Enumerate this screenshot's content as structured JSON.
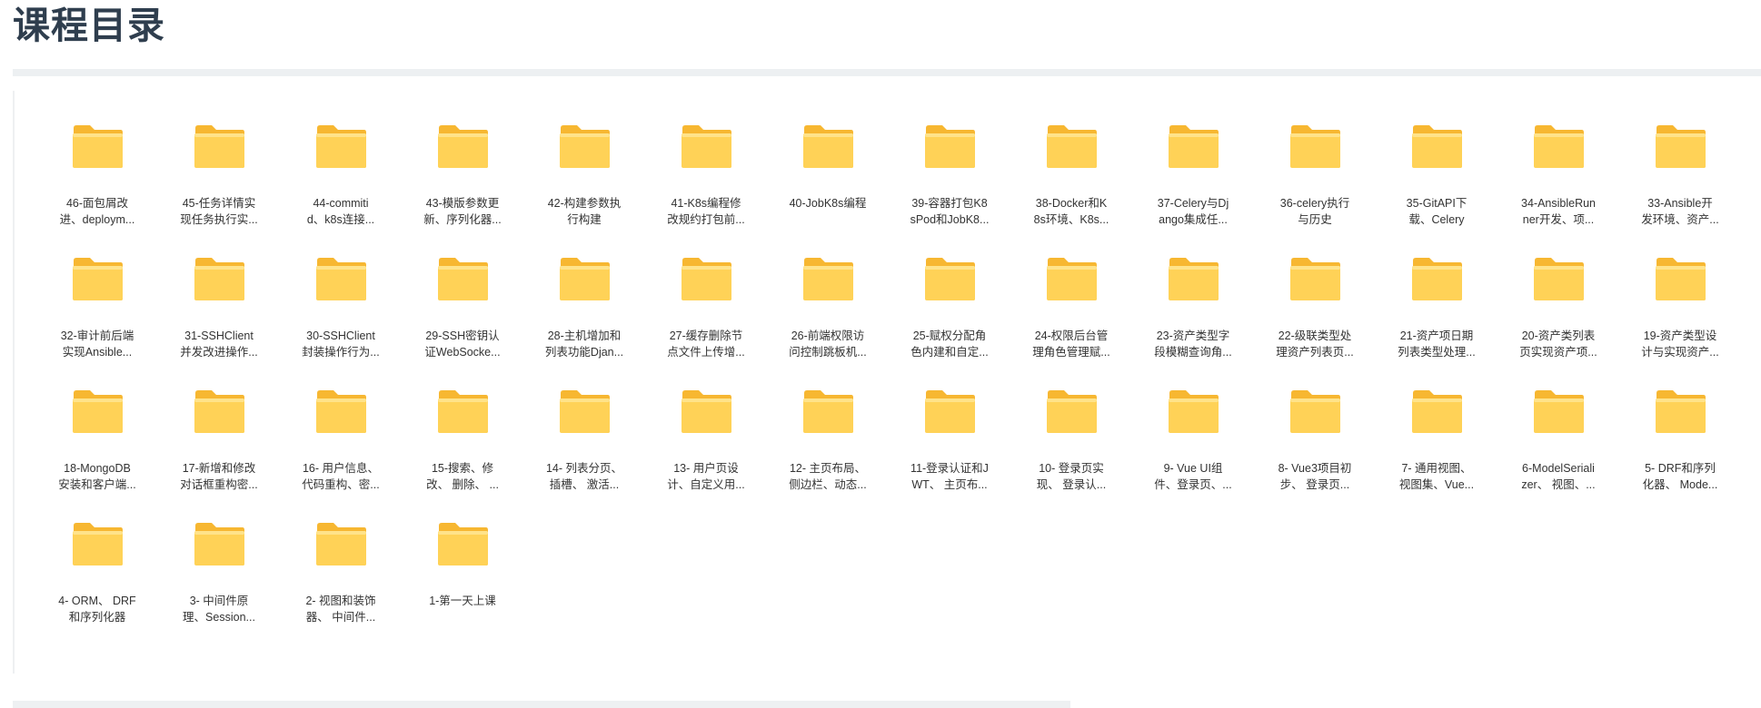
{
  "page": {
    "title": "课程目录"
  },
  "colors": {
    "folder_back": "#f7b731",
    "folder_front": "#ffd257",
    "folder_light": "#ffe38a"
  },
  "folders": [
    {
      "label1": "46-面包屑改",
      "label2": "进、deploym..."
    },
    {
      "label1": "45-任务详情实",
      "label2": "现任务执行实..."
    },
    {
      "label1": "44-commiti",
      "label2": "d、k8s连接..."
    },
    {
      "label1": "43-模版参数更",
      "label2": "新、序列化器..."
    },
    {
      "label1": "42-构建参数执",
      "label2": "行构建"
    },
    {
      "label1": "41-K8s编程修",
      "label2": "改规约打包前..."
    },
    {
      "label1": "40-JobK8s编程",
      "label2": ""
    },
    {
      "label1": "39-容器打包K8",
      "label2": "sPod和JobK8..."
    },
    {
      "label1": "38-Docker和K",
      "label2": "8s环境、K8s..."
    },
    {
      "label1": "37-Celery与Dj",
      "label2": "ango集成任..."
    },
    {
      "label1": "36-celery执行",
      "label2": "与历史"
    },
    {
      "label1": "35-GitAPI下",
      "label2": "载、Celery"
    },
    {
      "label1": "34-AnsibleRun",
      "label2": "ner开发、项..."
    },
    {
      "label1": "33-Ansible开",
      "label2": "发环境、资产..."
    },
    {
      "label1": "32-审计前后端",
      "label2": "实现Ansible..."
    },
    {
      "label1": "31-SSHClient",
      "label2": "并发改进操作..."
    },
    {
      "label1": "30-SSHClient",
      "label2": "封装操作行为..."
    },
    {
      "label1": "29-SSH密钥认",
      "label2": "证WebSocke..."
    },
    {
      "label1": "28-主机增加和",
      "label2": "列表功能Djan..."
    },
    {
      "label1": "27-缓存删除节",
      "label2": "点文件上传增..."
    },
    {
      "label1": "26-前端权限访",
      "label2": "问控制跳板机..."
    },
    {
      "label1": "25-赋权分配角",
      "label2": "色内建和自定..."
    },
    {
      "label1": "24-权限后台管",
      "label2": "理角色管理赋..."
    },
    {
      "label1": "23-资产类型字",
      "label2": "段模糊查询角..."
    },
    {
      "label1": "22-级联类型处",
      "label2": "理资产列表页..."
    },
    {
      "label1": "21-资产项日期",
      "label2": "列表类型处理..."
    },
    {
      "label1": "20-资产类列表",
      "label2": "页实现资产项..."
    },
    {
      "label1": "19-资产类型设",
      "label2": "计与实现资产..."
    },
    {
      "label1": "18-MongoDB",
      "label2": "安装和客户端..."
    },
    {
      "label1": "17-新增和修改",
      "label2": "对话框重构密..."
    },
    {
      "label1": "16- 用户信息、",
      "label2": "代码重构、密..."
    },
    {
      "label1": "15-搜索、修",
      "label2": "改、 删除、 ..."
    },
    {
      "label1": "14- 列表分页、",
      "label2": "插槽、 激活..."
    },
    {
      "label1": "13- 用户页设",
      "label2": "计、自定义用..."
    },
    {
      "label1": "12- 主页布局、",
      "label2": "侧边栏、动态..."
    },
    {
      "label1": "11-登录认证和J",
      "label2": "WT、 主页布..."
    },
    {
      "label1": "10- 登录页实",
      "label2": "现、 登录认..."
    },
    {
      "label1": "9- Vue UI组",
      "label2": "件、登录页、..."
    },
    {
      "label1": "8- Vue3项目初",
      "label2": "步、 登录页..."
    },
    {
      "label1": "7- 通用视图、",
      "label2": "视图集、Vue..."
    },
    {
      "label1": "6-ModelSeriali",
      "label2": "zer、 视图、..."
    },
    {
      "label1": "5- DRF和序列",
      "label2": "化器、 Mode..."
    },
    {
      "label1": "4- ORM、 DRF",
      "label2": "和序列化器"
    },
    {
      "label1": "3- 中间件原",
      "label2": "理、Session..."
    },
    {
      "label1": "2- 视图和装饰",
      "label2": "器、 中间件..."
    },
    {
      "label1": "1-第一天上课",
      "label2": ""
    }
  ]
}
